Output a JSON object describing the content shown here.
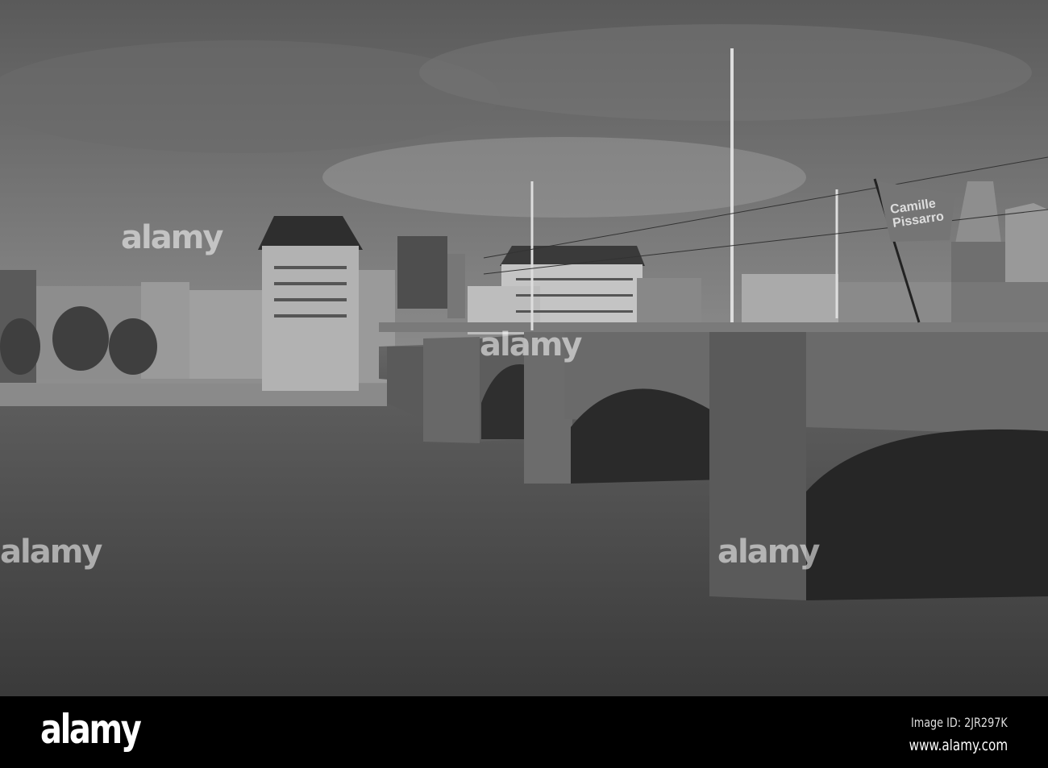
{
  "photo": {
    "subject": "bridge-over-river",
    "flag_text": [
      "Camille",
      "Pissarro"
    ]
  },
  "watermark": {
    "text": "alamy"
  },
  "footer": {
    "logo": "alamy",
    "image_id": "Image ID: 2JR297K",
    "website": "www.alamy.com"
  }
}
